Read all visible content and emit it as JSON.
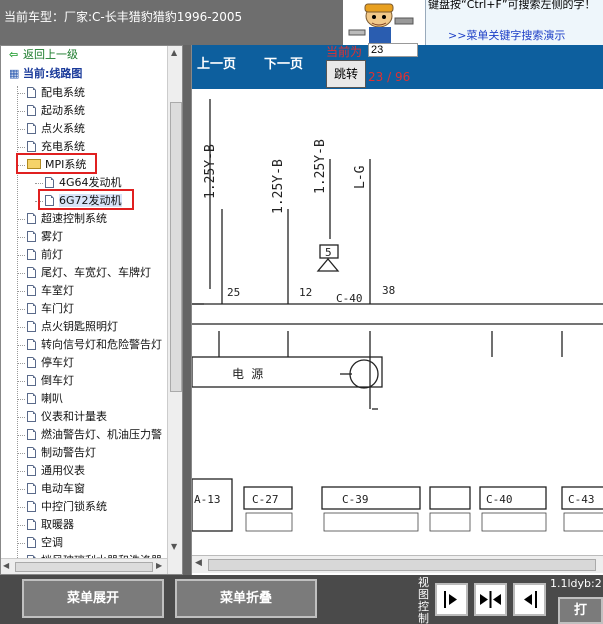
{
  "header": {
    "title": "当前车型：厂家:C-长丰猎豹猎豹1996-2005",
    "tip_text": "键盘按“Ctrl+F”可搜索左侧的字！",
    "tip_link": ">>菜单关键字搜索演示"
  },
  "tree": {
    "back_label": "返回上一级",
    "current_label": "当前:线路图",
    "items": [
      "配电系统",
      "起动系统",
      "点火系统",
      "充电系统",
      "MPI系统",
      "4G64发动机",
      "6G72发动机",
      "超速控制系统",
      "雾灯",
      "前灯",
      "尾灯、车宽灯、车牌灯",
      "车室灯",
      "车门灯",
      "点火钥匙照明灯",
      "转向信号灯和危险警告灯",
      "停车灯",
      "倒车灯",
      "喇叭",
      "仪表和计量表",
      "燃油警告灯、机油压力警",
      "制动警告灯",
      "通用仪表",
      "电动车窗",
      "中控门锁系统",
      "取暖器",
      "空调",
      "挡风玻璃刮水器和洗涤器"
    ]
  },
  "viewer": {
    "prev_label": "上一页",
    "next_label": "下一页",
    "page_label": "当前为",
    "page_value": "23",
    "jump_label": "跳转",
    "page_count": "23 / 96"
  },
  "diagram": {
    "wire_labels": [
      "1.25Y-B",
      "1.25Y-B",
      "1.25Y-B",
      "L-G"
    ],
    "pins": [
      "25",
      "12",
      "38"
    ],
    "connectors": [
      "C-40",
      "A-13",
      "C-27",
      "C-39",
      "C-40",
      "C-43"
    ],
    "box_label": "电 源",
    "connector_5": "5"
  },
  "bottom": {
    "expand_label": "菜单展开",
    "collapse_label": "菜单折叠",
    "view_label": "视图控制",
    "zoom_text": "1.1ldyb:2",
    "print_label": "打"
  }
}
